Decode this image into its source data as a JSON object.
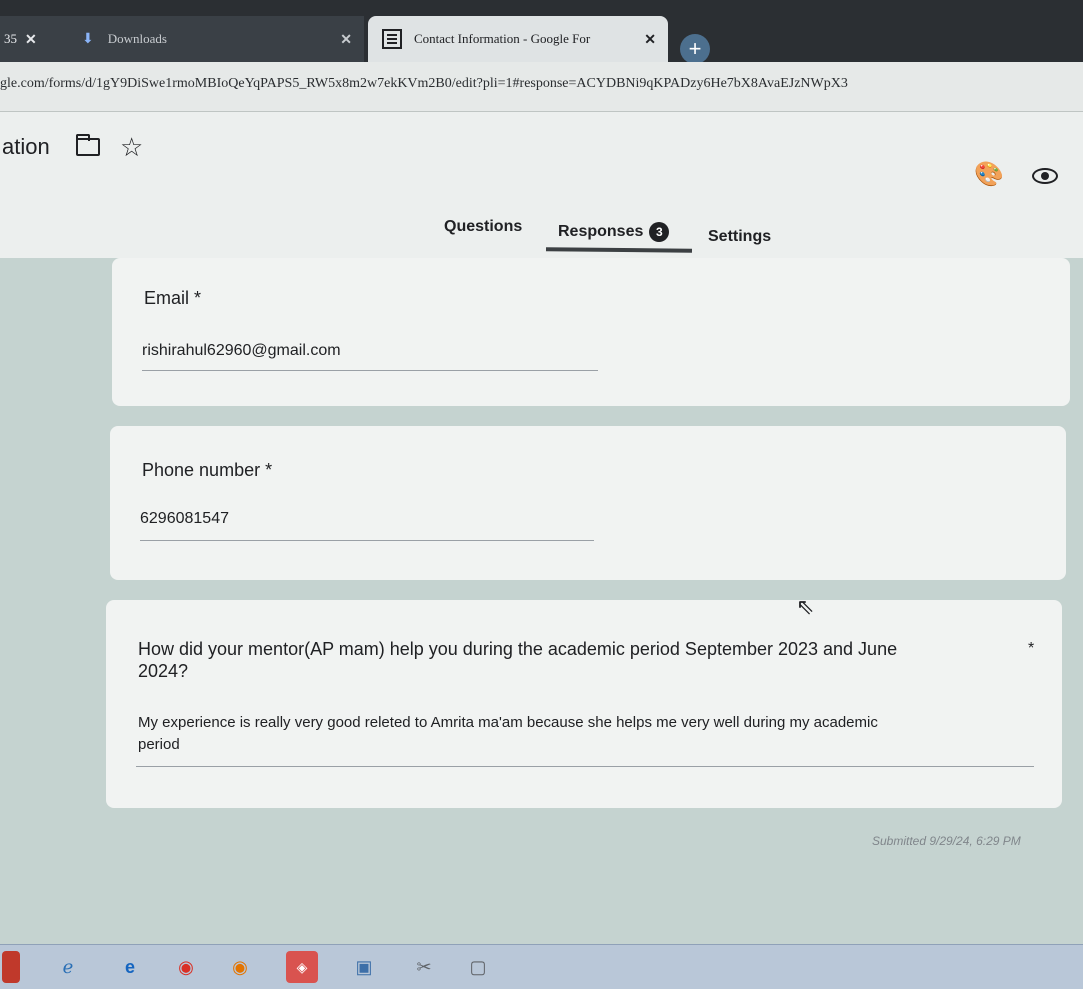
{
  "browser": {
    "tabs": [
      {
        "label": "35",
        "close": "✕"
      },
      {
        "label": "Downloads",
        "close": "✕"
      },
      {
        "label": "Contact Information - Google For",
        "close": "✕"
      }
    ],
    "new_tab": "+",
    "url": "gle.com/forms/d/1gY9DiSwe1rmoMBIoQeYqPAPS5_RW5x8m2w7ekKVm2B0/edit?pli=1#response=ACYDBNi9qKPADzy6He7bX8AvaEJzNWpX3"
  },
  "form_header": {
    "title": "ation",
    "tabs": {
      "questions": "Questions",
      "responses": "Responses",
      "responses_count": "3",
      "settings": "Settings"
    }
  },
  "responses": [
    {
      "question": "Email",
      "required": "*",
      "answer": "rishirahul62960@gmail.com"
    },
    {
      "question": "Phone number",
      "required": "*",
      "answer": "6296081547"
    },
    {
      "question_line1": "How  did your mentor(AP mam)  help you during the academic period September 2023 and June",
      "question_line2": "2024?",
      "required": "*",
      "answer_line1": "My experience is really very good releted to Amrita ma'am because she helps me very well during my academic",
      "answer_line2": "period"
    }
  ],
  "submitted": "Submitted 9/29/24, 6:29 PM",
  "icons": {
    "download": "download-icon",
    "forms": "google-forms-icon",
    "folder": "folder-icon",
    "star": "star-icon",
    "palette": "palette-icon",
    "preview": "eye-icon",
    "cursor": "mouse-cursor-icon"
  },
  "colors": {
    "tabbar": "#2b2f33",
    "page_background": "#c5d3d0",
    "card": "#f1f3f2",
    "text": "#202124",
    "taskbar": "#b9c7d8"
  }
}
